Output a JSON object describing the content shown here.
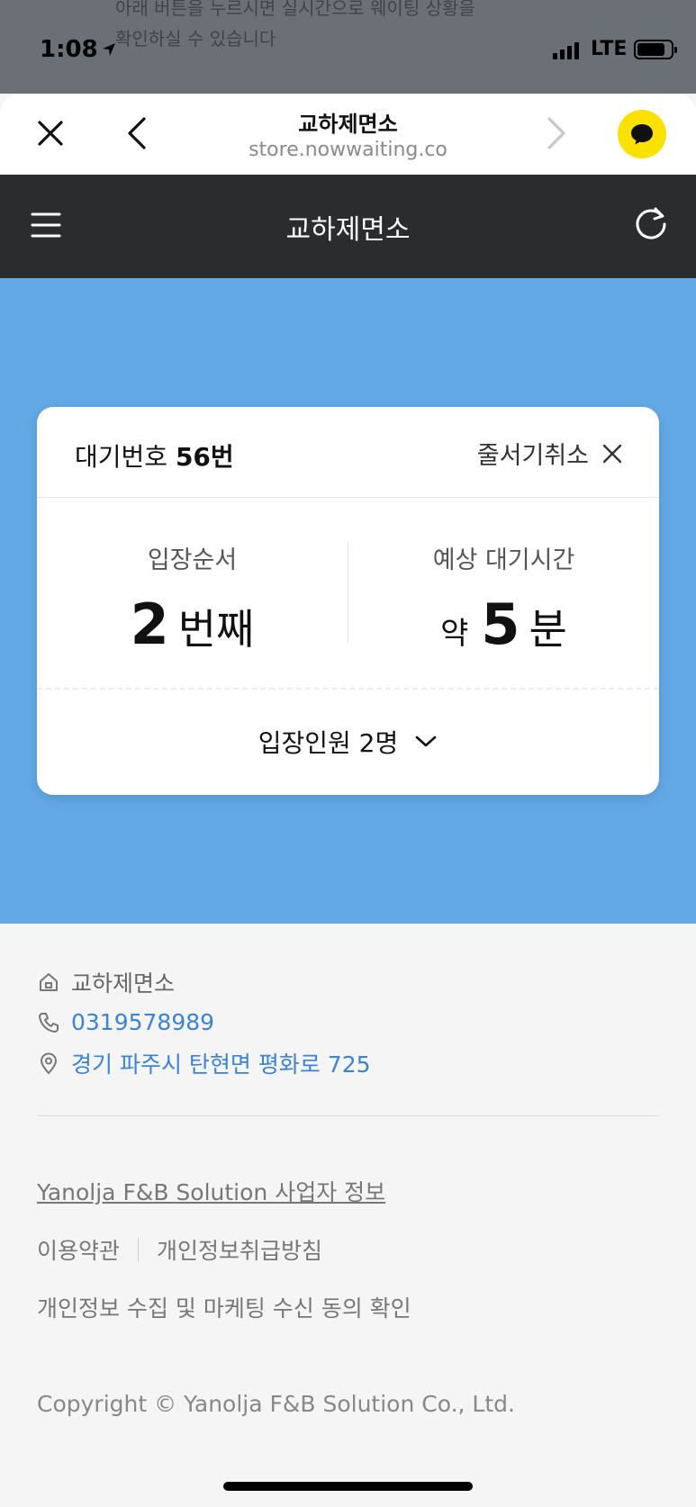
{
  "background_text": [
    "아래 버튼을 누르시면 실시간으로 웨이팅 상황을",
    "확인하실 수 있습니다"
  ],
  "status_bar": {
    "time": "1:08",
    "network": "LTE"
  },
  "browser": {
    "title": "교하제면소",
    "url": "store.nowwaiting.co"
  },
  "app_header": {
    "title": "교하제면소"
  },
  "ticket": {
    "label": "대기번호",
    "number": "56번",
    "cancel_label": "줄서기취소",
    "order_label": "입장순서",
    "order_value": "2",
    "order_unit": "번째",
    "wait_label": "예상 대기시간",
    "wait_prefix": "약",
    "wait_value": "5",
    "wait_unit": "분",
    "party_label": "입장인원 2명"
  },
  "store_info": {
    "name": "교하제면소",
    "phone": "0319578989",
    "address": "경기 파주시 탄현면 평화로 725"
  },
  "footer": {
    "company_info": "Yanolja F&B Solution 사업자 정보",
    "terms": "이용약관",
    "privacy": "개인정보취급방침",
    "consent": "개인정보 수집 및 마케팅 수신 동의 확인",
    "copyright": "Copyright © Yanolja F&B Solution Co., Ltd."
  },
  "colors": {
    "hero": "#63a9e6",
    "header": "#2b2c2e",
    "link": "#3c83d6",
    "chat": "#fae100"
  }
}
